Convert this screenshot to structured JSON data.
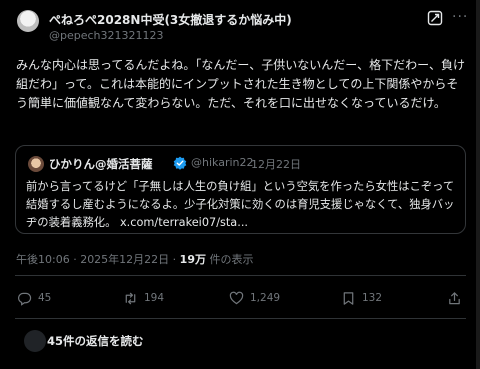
{
  "author": {
    "display_name": "ぺねろぺ2028N中受(3女撤退するか悩み中)",
    "handle": "@pepech321321123"
  },
  "post": {
    "text": "みんな内心は思ってるんだよね。「なんだー、子供いないんだー、格下だわー、負け組だわ」って。これは本能的にインプットされた生き物としての上下関係やからそう簡単に価値観なんて変わらない。ただ、それを口に出せなくなっているだけ。"
  },
  "quote": {
    "display_name": "ひかりん@婚活菩薩",
    "handle": "@hikarin22",
    "separator": "·",
    "date": "12月22日",
    "text": "前から言ってるけど「子無しは人生の負け組」という空気を作ったら女性はこぞって結婚するし産むようになるよ。少子化対策に効くのは育児支援じゃなくて、独身バッヂの装着義務化。",
    "link": "x.com/terrakei07/sta..."
  },
  "meta": {
    "time": "午後10:06 · 2025年12月22日 · ",
    "views": "19万",
    "views_suffix": " 件の表示"
  },
  "actions": {
    "reply_count": "45",
    "repost_count": "194",
    "like_count": "1,249",
    "bookmark_count": "132"
  },
  "replies": {
    "label": "45件の返信を読む"
  },
  "icons": {
    "verified": "verified-badge-icon",
    "grok": "grok-icon",
    "more": "more-icon",
    "reply": "reply-icon",
    "repost": "repost-icon",
    "like": "like-icon",
    "bookmark": "bookmark-icon",
    "share": "share-icon"
  },
  "colors": {
    "background": "#000000",
    "text": "#e7e9ea",
    "muted": "#71767b",
    "border": "#2f3336",
    "verified": "#1d9bf0"
  }
}
